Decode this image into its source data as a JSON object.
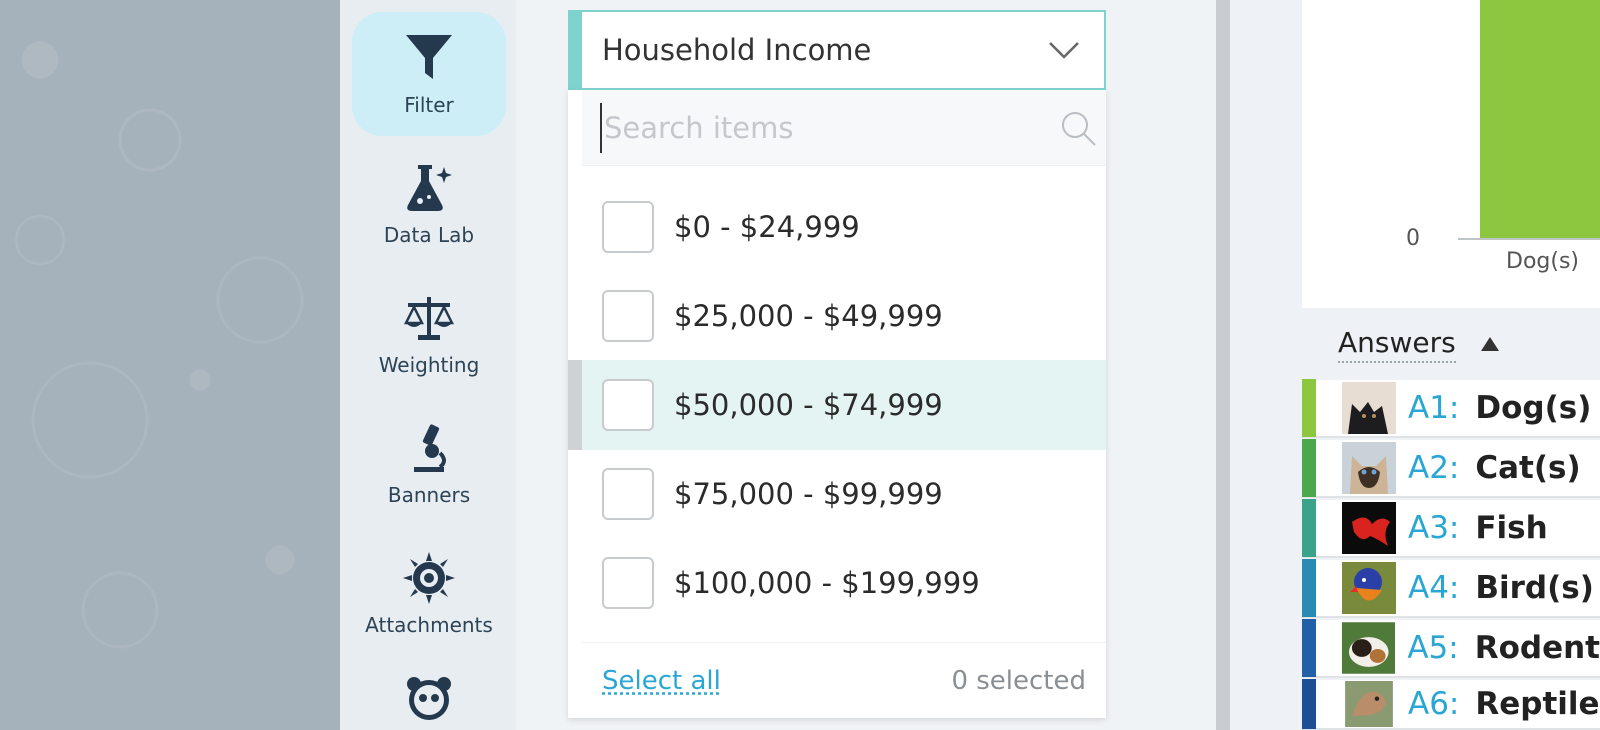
{
  "rail": {
    "items": [
      {
        "label": "Filter",
        "icon": "funnel-icon"
      },
      {
        "label": "Data Lab",
        "icon": "flask-icon"
      },
      {
        "label": "Weighting",
        "icon": "scale-icon"
      },
      {
        "label": "Banners",
        "icon": "microscope-icon"
      },
      {
        "label": "Attachments",
        "icon": "sun-icon"
      },
      {
        "label": "",
        "icon": "panda-icon"
      }
    ]
  },
  "dropdown": {
    "title": "Household Income",
    "search_placeholder": "Search items",
    "items": [
      {
        "label": "$0 - $24,999"
      },
      {
        "label": "$25,000 - $49,999"
      },
      {
        "label": "$50,000 - $74,999"
      },
      {
        "label": "$75,000 - $99,999"
      },
      {
        "label": "$100,000 - $199,999"
      }
    ],
    "select_all": "Select all",
    "selected_count": "0 selected"
  },
  "chart": {
    "zero_tick": "0",
    "category": "Dog(s)",
    "bar_color": "#8dc63f"
  },
  "answers": {
    "title": "Answers",
    "rows": [
      {
        "code": "A1:",
        "text": "Dog(s)",
        "color": "#8dc63f"
      },
      {
        "code": "A2:",
        "text": "Cat(s)",
        "color": "#4ca84a"
      },
      {
        "code": "A3:",
        "text": "Fish",
        "color": "#3aa38a"
      },
      {
        "code": "A4:",
        "text": "Bird(s)",
        "color": "#2b8ab3"
      },
      {
        "code": "A5:",
        "text": "Rodent",
        "color": "#215fa6"
      },
      {
        "code": "A6:",
        "text": "Reptile",
        "color": "#1d4f94"
      }
    ]
  }
}
